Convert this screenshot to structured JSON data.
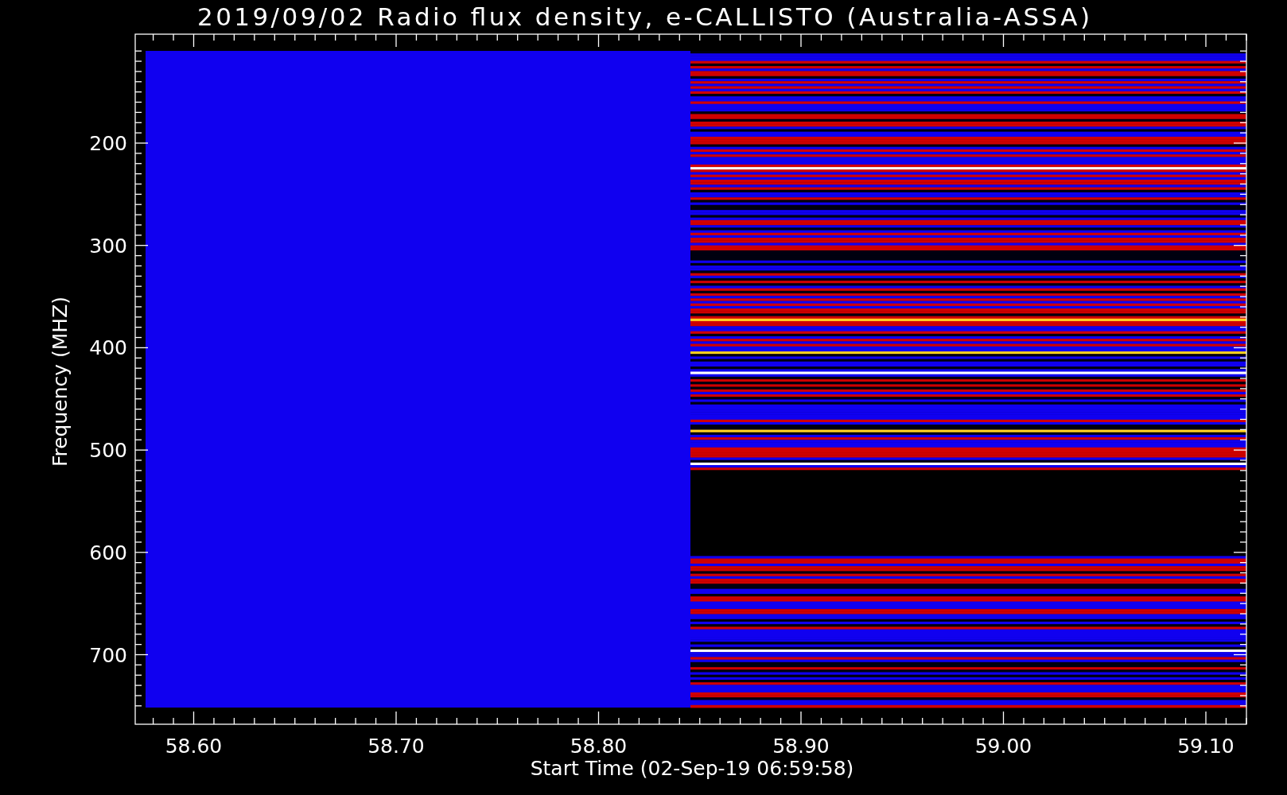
{
  "title": "2019/09/02  Radio flux density, e-CALLISTO (Australia-ASSA)",
  "plot": {
    "ylabel": "Frequency (MHZ)",
    "xlabel": "Start Time (02-Sep-19 06:59:58)",
    "yticks": [
      "200",
      "300",
      "400",
      "500",
      "600",
      "700"
    ],
    "xticks": [
      "58.60",
      "58.70",
      "58.80",
      "58.90",
      "59.00",
      "59.10"
    ]
  }
}
